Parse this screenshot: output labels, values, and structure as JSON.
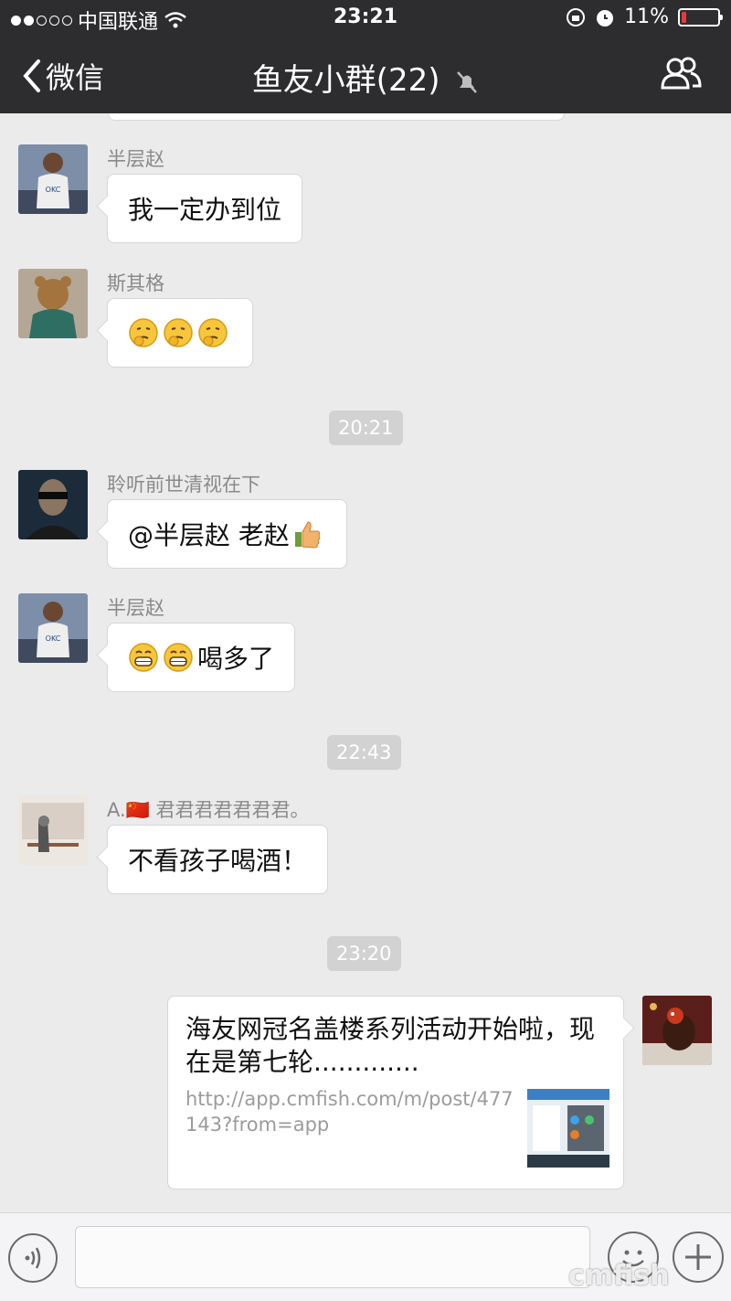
{
  "status_bar": {
    "carrier": "中国联通",
    "time": "23:21",
    "battery": "11%"
  },
  "nav": {
    "back_label": "微信",
    "title": "鱼友小群(22)"
  },
  "messages": [
    {
      "sender": "半层赵",
      "text": "我一定办到位"
    },
    {
      "sender": "斯其格",
      "text": ""
    },
    {
      "timestamp": "20:21"
    },
    {
      "sender": "聆听前世清视在下",
      "text": "@半层赵 老赵"
    },
    {
      "sender": "半层赵",
      "text": "喝多了"
    },
    {
      "timestamp": "22:43"
    },
    {
      "sender": "A.🇨🇳 君君君君君君君。",
      "text": "不看孩子喝酒！"
    },
    {
      "timestamp": "23:20"
    }
  ],
  "link_card": {
    "title": "海友网冠名盖楼系列活动开始啦，现在是第七轮.............",
    "url": "http://app.cmfish.com/m/post/477143?from=app"
  },
  "watermark": "cmfish",
  "colors": {
    "nav_bg": "#2d2d30",
    "chat_bg": "#ebebeb",
    "bubble": "#ffffff",
    "timestamp_bg": "#d2d2d2"
  }
}
